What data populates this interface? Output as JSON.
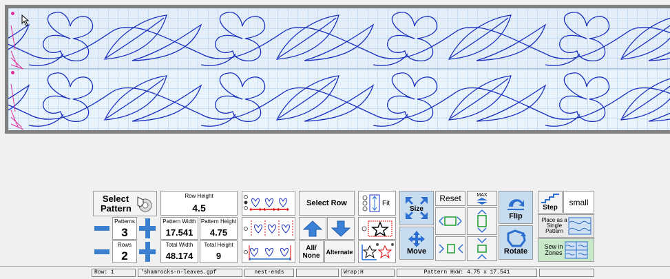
{
  "pattern_panel": {
    "select_pattern": "Select Pattern",
    "patterns_label": "Patterns",
    "patterns_value": "3",
    "rows_label": "Rows",
    "rows_value": "2"
  },
  "dimensions": {
    "row_height_label": "Row Height",
    "row_height_value": "4.5",
    "pattern_width_label": "Pattern Width",
    "pattern_width_value": "17.541",
    "pattern_height_label": "Pattern Height",
    "pattern_height_value": "4.75",
    "total_width_label": "Total Width",
    "total_width_value": "48.174",
    "total_height_label": "Total Height",
    "total_height_value": "9"
  },
  "row_selection": {
    "select_row": "Select Row",
    "all_none": "All/ None",
    "alternate": "Alternate"
  },
  "fit": {
    "fit_label": "Fit"
  },
  "transform": {
    "size": "Size",
    "reset": "Reset",
    "max": "MAX",
    "flip": "Flip",
    "move": "Move",
    "rotate": "Rotate"
  },
  "right_panel": {
    "step": "Step",
    "step_value": "small",
    "place_single": "Place as a Single Pattern",
    "sew_zones": "Sew in Zones"
  },
  "status_bar": {
    "row": "Row: 1",
    "file": "'shamrocks-n-leaves.gpf",
    "mode": "nest-ends",
    "blank": "",
    "wrap": "Wrap:H",
    "pattern_size": "Pattern HxW: 4.75 x 17.541"
  },
  "colors": {
    "pattern_stroke": "#1a2fbf",
    "grid": "#9ec3e8",
    "marker": "#e0309a"
  }
}
